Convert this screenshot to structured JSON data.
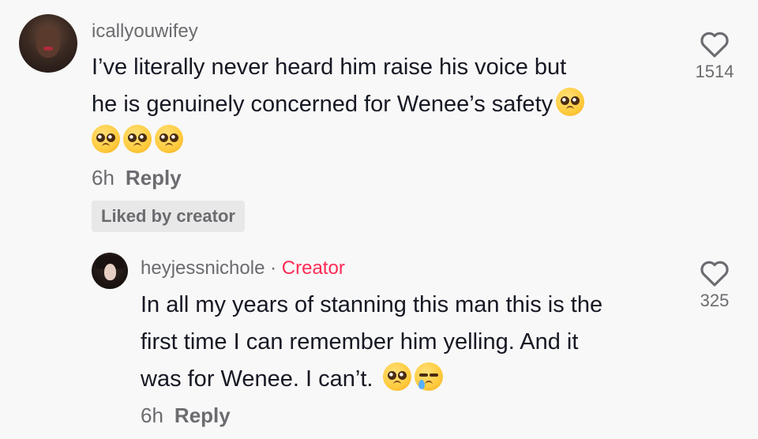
{
  "comments": [
    {
      "username": "icallyouwifey",
      "text_line1": "I’ve literally never heard him raise his voice but",
      "text_line2": "he is genuinely concerned for Wenee’s safety",
      "emojis": [
        "pleading-face",
        "pleading-face",
        "pleading-face",
        "pleading-face"
      ],
      "time": "6h",
      "reply_label": "Reply",
      "liked_badge": "Liked by creator",
      "likes": "1514"
    }
  ],
  "reply": {
    "username": "heyjessnichole",
    "separator": "·",
    "creator_label": "Creator",
    "text_line1": "In all my years of stanning this man this is the",
    "text_line2": "first time I can remember him yelling. And it",
    "text_line3": "was for Wenee. I can’t.",
    "emojis": [
      "pleading-face",
      "crying-face"
    ],
    "time": "6h",
    "reply_label": "Reply",
    "likes": "325"
  },
  "colors": {
    "background": "#f8f8f8",
    "text": "#161823",
    "muted": "#6b6b70",
    "creator": "#fe2c55",
    "badge_bg": "#e8e8e8"
  }
}
